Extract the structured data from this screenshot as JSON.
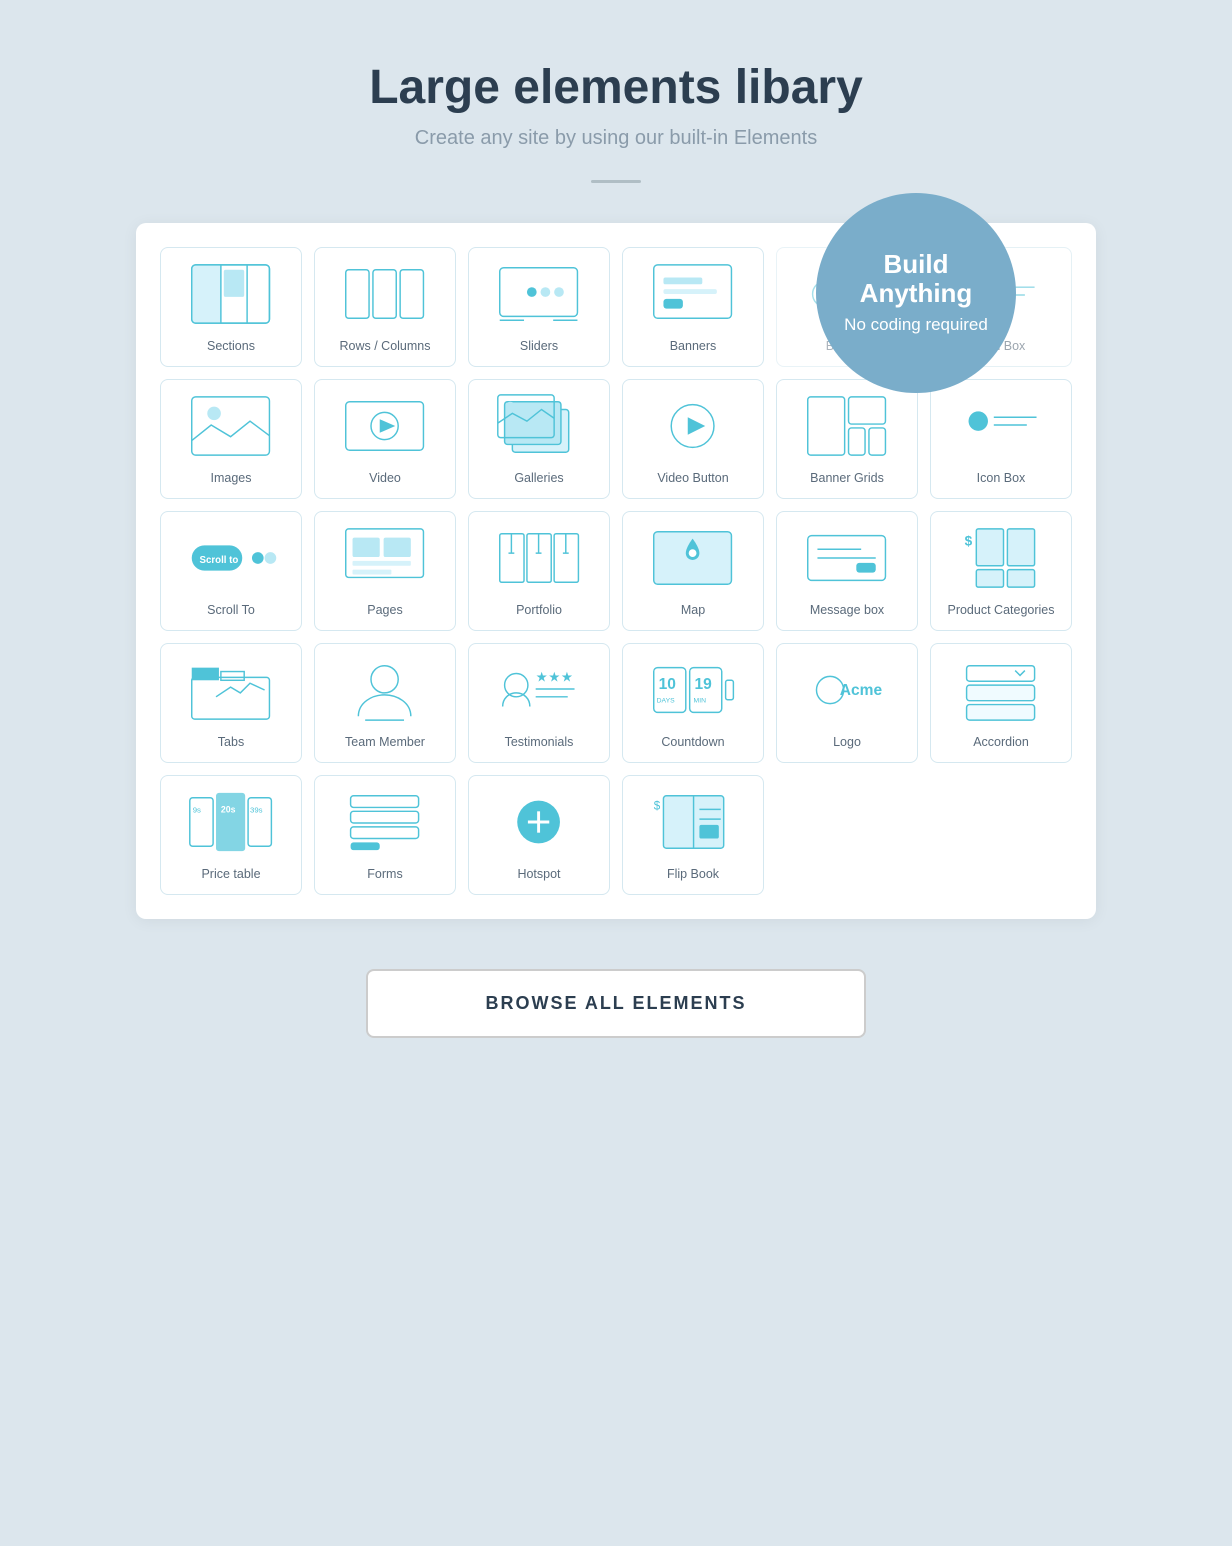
{
  "header": {
    "title": "Large elements libary",
    "subtitle": "Create any site by using our built-in Elements"
  },
  "bubble": {
    "line1": "Build Anything",
    "line2": "No coding required"
  },
  "elements": [
    {
      "id": "sections",
      "label": "Sections",
      "type": "sections"
    },
    {
      "id": "rows-cols",
      "label": "Rows / Columns",
      "type": "rows"
    },
    {
      "id": "sliders",
      "label": "Sliders",
      "type": "sliders"
    },
    {
      "id": "banners",
      "label": "Banners",
      "type": "banners"
    },
    {
      "id": "buttons",
      "label": "Buttons",
      "type": "buttons"
    },
    {
      "id": "icon-box",
      "label": "Icon Box",
      "type": "iconbox"
    },
    {
      "id": "images",
      "label": "Images",
      "type": "images"
    },
    {
      "id": "video",
      "label": "Video",
      "type": "video"
    },
    {
      "id": "galleries",
      "label": "Galleries",
      "type": "galleries"
    },
    {
      "id": "video-button",
      "label": "Video Button",
      "type": "videobutton"
    },
    {
      "id": "banner-grids",
      "label": "Banner Grids",
      "type": "bannergrids"
    },
    {
      "id": "icon-box2",
      "label": "Icon Box",
      "type": "iconbox2"
    },
    {
      "id": "scroll-to",
      "label": "Scroll To",
      "type": "scrollto"
    },
    {
      "id": "pages",
      "label": "Pages",
      "type": "pages"
    },
    {
      "id": "portfolio",
      "label": "Portfolio",
      "type": "portfolio"
    },
    {
      "id": "map",
      "label": "Map",
      "type": "map"
    },
    {
      "id": "message-box",
      "label": "Message box",
      "type": "messagebox"
    },
    {
      "id": "product-cat",
      "label": "Product Categories",
      "type": "productcat"
    },
    {
      "id": "tabs",
      "label": "Tabs",
      "type": "tabs"
    },
    {
      "id": "team-member",
      "label": "Team Member",
      "type": "teammember"
    },
    {
      "id": "testimonials",
      "label": "Testimonials",
      "type": "testimonials"
    },
    {
      "id": "countdown",
      "label": "Countdown",
      "type": "countdown"
    },
    {
      "id": "logo",
      "label": "Logo",
      "type": "logo"
    },
    {
      "id": "accordion",
      "label": "Accordion",
      "type": "accordion"
    },
    {
      "id": "price-table",
      "label": "Price table",
      "type": "pricetable"
    },
    {
      "id": "forms",
      "label": "Forms",
      "type": "forms"
    },
    {
      "id": "hotspot",
      "label": "Hotspot",
      "type": "hotspot"
    },
    {
      "id": "flip-book",
      "label": "Flip Book",
      "type": "flipbook"
    }
  ],
  "browse_button": "BROWSE ALL ELEMENTS"
}
